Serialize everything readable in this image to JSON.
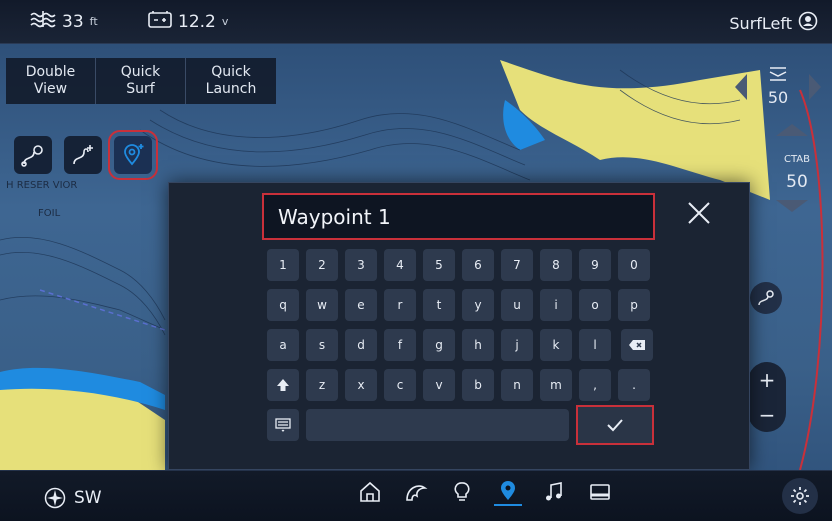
{
  "status": {
    "depth_value": "33",
    "depth_unit": "ft",
    "battery_value": "12.2",
    "battery_unit": "v",
    "profile_name": "SurfLeft"
  },
  "quick_buttons": [
    {
      "label": "Double\nView"
    },
    {
      "label": "Quick\nSurf"
    },
    {
      "label": "Quick\nLaunch"
    }
  ],
  "map_labels": {
    "reservoir": "H RESER VIOR",
    "foil": "FOIL"
  },
  "right_panel": {
    "speed_value": "50",
    "ctab_label": "CTAB",
    "ctab_value": "50"
  },
  "dialog": {
    "name_value": "Waypoint 1",
    "keys_row1": [
      "1",
      "2",
      "3",
      "4",
      "5",
      "6",
      "7",
      "8",
      "9",
      "0"
    ],
    "keys_row2": [
      "q",
      "w",
      "e",
      "r",
      "t",
      "y",
      "u",
      "i",
      "o",
      "p"
    ],
    "keys_row3": [
      "a",
      "s",
      "d",
      "f",
      "g",
      "h",
      "j",
      "k",
      "l"
    ],
    "keys_row4": [
      "z",
      "x",
      "c",
      "v",
      "b",
      "n",
      "m",
      ",",
      "."
    ]
  },
  "bottom": {
    "compass_dir": "SW"
  },
  "colors": {
    "highlight": "#c9303a",
    "accent_blue": "#1f8be0",
    "land": "#e6e07a"
  }
}
